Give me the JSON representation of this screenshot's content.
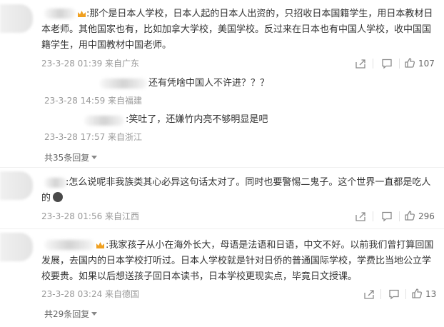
{
  "comments": [
    {
      "text": ":那个是日本人学校，日本人起的日本人出资的，只招收日本国籍学生，用日本教材日本老师。其他国家也有，比如加拿大学校，美国学校。反过来在日本也有中国人学校，收中国国籍学生，用中国教材中国老师。",
      "meta": "23-3-28 01:39 来自广东",
      "likes": "107"
    },
    {
      "text": ":怎么说呢非我族类其心必异这句话太对了。同时也要警惕二鬼子。这个世界一直都是吃人的",
      "meta": "23-3-28 01:56 来自江西",
      "likes": "296"
    },
    {
      "text": ":我家孩子从小在海外长大，母语是法语和日语，中文不好。以前我们曾打算回国发展，去国内的日本学校打听过。日本人学校就是针对日侨的普通国际学校，学费比当地公立学校要贵。如果以后想送孩子回日本读书，日本学校更现实点，毕竟日文授课。",
      "meta": "23-3-28 03:24 来自德国",
      "likes": "13"
    }
  ],
  "replies": [
    {
      "text": "还有凭啥中国人不许进？？？",
      "meta": "23-3-28 14:59 来自福建"
    },
    {
      "text": ":笑吐了，还嫌竹内亮不够明显是吧",
      "meta": "23-3-28 17:57 来自浙江"
    }
  ],
  "more_replies": [
    "共35条回复",
    "共29条回复"
  ],
  "icons": [
    "crown-icon",
    "share-icon",
    "comment-icon",
    "like-icon",
    "caret-down-icon"
  ]
}
